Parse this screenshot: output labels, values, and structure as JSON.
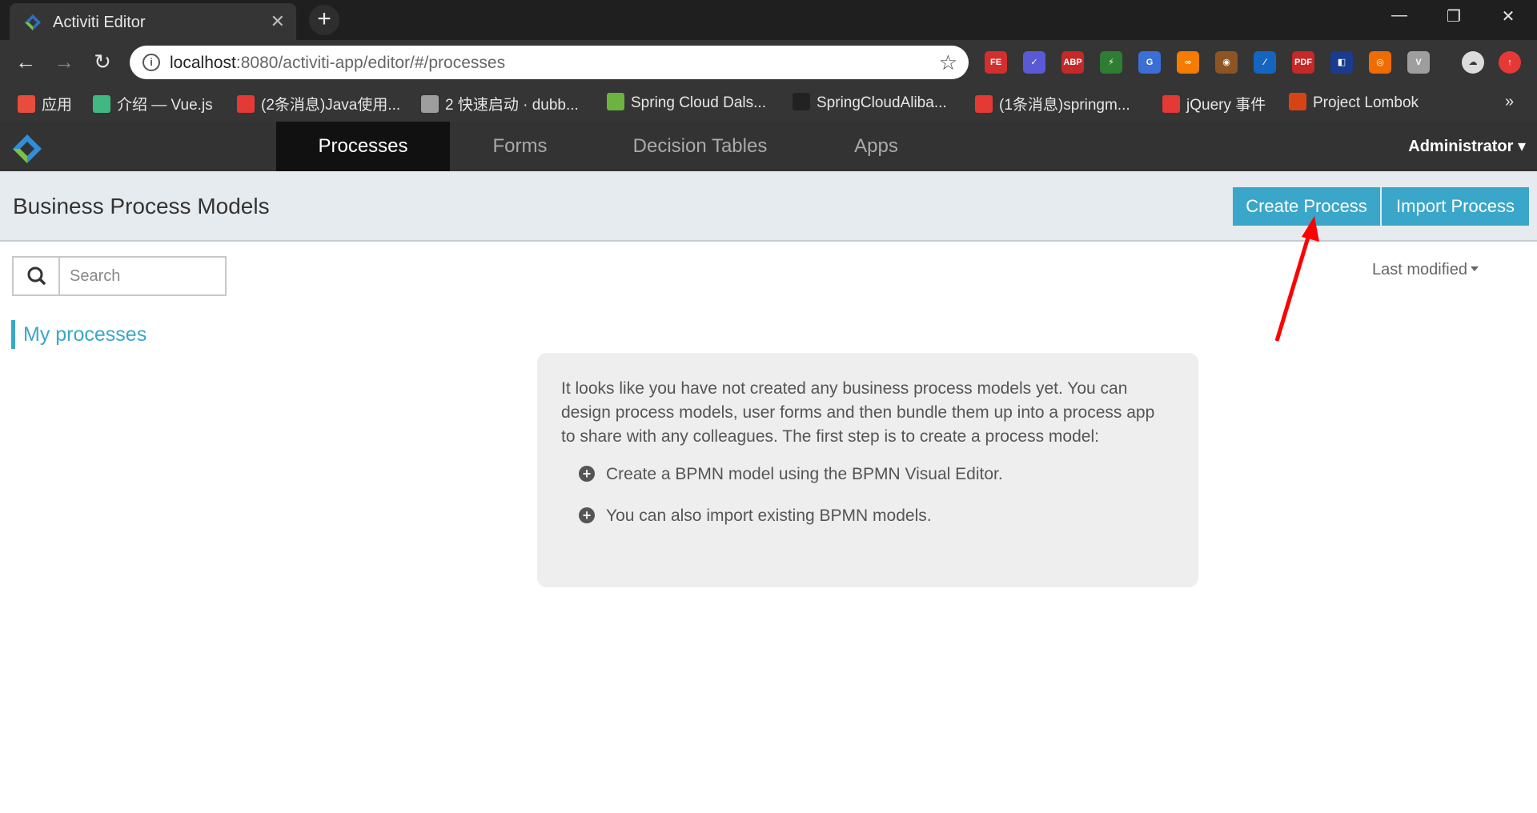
{
  "browser": {
    "tab_title": "Activiti Editor",
    "tab_close": "✕",
    "new_tab": "+",
    "window_controls": [
      "—",
      "❐",
      "✕"
    ],
    "url_host": "localhost",
    "url_rest": ":8080/activiti-app/editor/#/processes",
    "extensions": [
      {
        "label": "FE",
        "color": "#d32f2f"
      },
      {
        "label": "✓",
        "color": "#5a5ad6"
      },
      {
        "label": "ABP",
        "color": "#c62828"
      },
      {
        "label": "⚡",
        "color": "#2e7d32"
      },
      {
        "label": "G",
        "color": "#3b6fd6"
      },
      {
        "label": "∞",
        "color": "#f57c00"
      },
      {
        "label": "◉",
        "color": "#8d5524"
      },
      {
        "label": "∕",
        "color": "#1565c0"
      },
      {
        "label": "PDF",
        "color": "#c62828"
      },
      {
        "label": "◧",
        "color": "#1a3b8f"
      },
      {
        "label": "◎",
        "color": "#ef6c00"
      },
      {
        "label": "V",
        "color": "#9e9e9e"
      }
    ],
    "bookmarks": [
      {
        "label": "应用",
        "color": "#e74c3c"
      },
      {
        "label": "介绍 — Vue.js",
        "color": "#41b883"
      },
      {
        "label": "(2条消息)Java使用...",
        "color": "#e53935"
      },
      {
        "label": "2 快速启动 · dubb...",
        "color": "#9e9e9e"
      },
      {
        "label": "Spring Cloud Dals...",
        "color": "#6db33f"
      },
      {
        "label": "SpringCloudAliba...",
        "color": "#222222"
      },
      {
        "label": "(1条消息)springm...",
        "color": "#e53935"
      },
      {
        "label": "jQuery 事件",
        "color": "#e53935"
      },
      {
        "label": "Project Lombok",
        "color": "#d84315"
      }
    ],
    "bookmarks_more": "»"
  },
  "app": {
    "nav_tabs": [
      "Processes",
      "Forms",
      "Decision Tables",
      "Apps"
    ],
    "user_menu": "Administrator"
  },
  "page": {
    "title": "Business Process Models",
    "create_button": "Create Process",
    "import_button": "Import Process",
    "search_placeholder": "Search",
    "sort_label": "Last modified",
    "filter_label": "My processes",
    "empty_intro": "It looks like you have not created any business process models yet. You can design process models, user forms and then bundle them up into a process app to share with any colleagues. The first step is to create a process model:",
    "empty_items": [
      "Create a BPMN model using the BPMN Visual Editor.",
      "You can also import existing BPMN models."
    ]
  },
  "colors": {
    "accent": "#3aa6c9",
    "annotation_arrow": "#ff0000"
  }
}
